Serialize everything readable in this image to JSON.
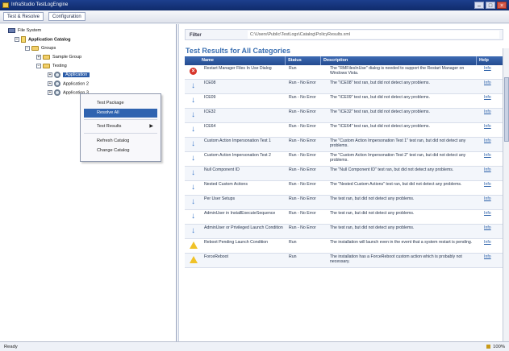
{
  "window": {
    "title": "InfraStudio TestLogEngine"
  },
  "menu": {
    "items": [
      {
        "label": "Test & Resolve"
      },
      {
        "label": "Configuration"
      }
    ]
  },
  "tree": {
    "items": [
      {
        "label": "File System"
      },
      {
        "label": "Application Catalog"
      },
      {
        "label": "Groups"
      },
      {
        "label": "Sample Group"
      },
      {
        "label": "Testing"
      },
      {
        "label": "Application"
      },
      {
        "label": "Application 2"
      },
      {
        "label": "Application 3"
      }
    ]
  },
  "context_menu": {
    "items": [
      {
        "label": "Test Package"
      },
      {
        "label": "Resolve All"
      },
      {
        "label": "Test Results"
      },
      {
        "label": "Refresh Catalog"
      },
      {
        "label": "Change Catalog"
      }
    ]
  },
  "filter": {
    "label": "Filter",
    "value": "C:\\Users\\Public\\TestLogs\\Catalog\\PolicyResults.xml"
  },
  "results": {
    "title": "Test Results for All Categories",
    "headers": [
      "Name",
      "Status",
      "Description",
      "Help"
    ],
    "rows": [
      {
        "name": "Restart Manager Files In Use Dialog",
        "status": "Run",
        "description": "The \"RMFilesInUse\" dialog is needed to support the Restart Manager on Windows Vista.",
        "help": "Info",
        "icon": "error-icon"
      },
      {
        "name": "ICE08",
        "status": "Run - No Error",
        "description": "The \"ICE08\" test ran, but did not detect any problems.",
        "help": "Info",
        "icon": "pass-icon"
      },
      {
        "name": "ICE09",
        "status": "Run - No Error",
        "description": "The \"ICE09\" test ran, but did not detect any problems.",
        "help": "Info",
        "icon": "pass-icon"
      },
      {
        "name": "ICE32",
        "status": "Run - No Error",
        "description": "The \"ICE32\" test ran, but did not detect any problems.",
        "help": "Info",
        "icon": "pass-icon"
      },
      {
        "name": "ICE64",
        "status": "Run - No Error",
        "description": "The \"ICE64\" test ran, but did not detect any problems.",
        "help": "Info",
        "icon": "pass-icon"
      },
      {
        "name": "Custom Action Impersonation Test 1",
        "status": "Run - No Error",
        "description": "The \"Custom Action Impersonation Test 1\" test ran, but did not detect any problems.",
        "help": "Info",
        "icon": "pass-icon"
      },
      {
        "name": "Custom Action Impersonation Test 2",
        "status": "Run - No Error",
        "description": "The \"Custom Action Impersonation Test 2\" test ran, but did not detect any problems.",
        "help": "Info",
        "icon": "pass-icon"
      },
      {
        "name": "Null Component ID",
        "status": "Run - No Error",
        "description": "The \"Null Component ID\" test ran, but did not detect any problems.",
        "help": "Info",
        "icon": "pass-icon"
      },
      {
        "name": "Nested Custom Actions",
        "status": "Run - No Error",
        "description": "The \"Nested Custom Actions\" test ran, but did not detect any problems.",
        "help": "Info",
        "icon": "pass-icon"
      },
      {
        "name": "Per User Setups",
        "status": "Run - No Error",
        "description": "The test ran, but did not detect any problems.",
        "help": "Info",
        "icon": "pass-icon"
      },
      {
        "name": "AdminUser in InstallExecuteSequence",
        "status": "Run - No Error",
        "description": "The test ran, but did not detect any problems.",
        "help": "Info",
        "icon": "pass-icon"
      },
      {
        "name": "AdminUser or Privileged Launch Condition",
        "status": "Run - No Error",
        "description": "The test ran, but did not detect any problems.",
        "help": "Info",
        "icon": "pass-icon"
      },
      {
        "name": "Reboot Pending Launch Condition",
        "status": "Run",
        "description": "The installation will launch even in the event that a system restart is pending.",
        "help": "Info",
        "icon": "warning-icon"
      },
      {
        "name": "ForceReboot",
        "status": "Run",
        "description": "The installation has a ForceReboot custom action which is probably not necessary.",
        "help": "Info",
        "icon": "warning-icon"
      }
    ]
  },
  "statusbar": {
    "text": "Ready",
    "right": "100%"
  }
}
